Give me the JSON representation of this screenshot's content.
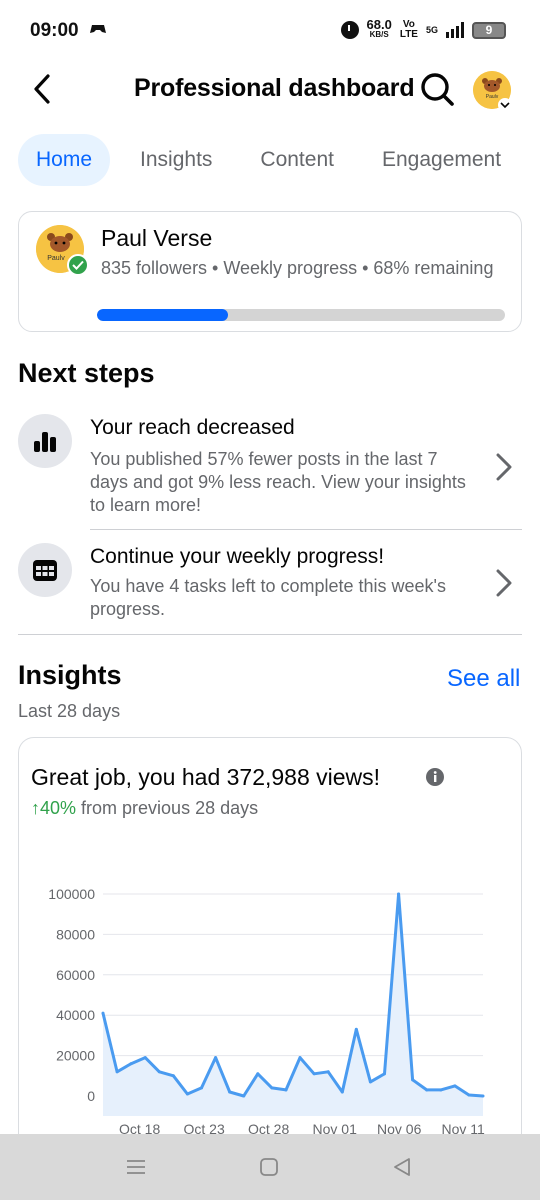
{
  "status_bar": {
    "time": "09:00",
    "speed_value": "68.0",
    "speed_unit": "KB/S",
    "volte_top": "Vo",
    "volte_bottom": "LTE",
    "network": "5G",
    "battery": "9"
  },
  "header": {
    "title": "Professional dashboard",
    "avatar_text": "Paulv"
  },
  "tabs": [
    {
      "label": "Home",
      "active": true
    },
    {
      "label": "Insights",
      "active": false
    },
    {
      "label": "Content",
      "active": false
    },
    {
      "label": "Engagement",
      "active": false
    }
  ],
  "profile": {
    "name": "Paul Verse",
    "meta": "835 followers • Weekly progress • 68% remaining",
    "avatar_text": "Paulv",
    "progress_fraction": 0.32
  },
  "next_steps": {
    "title": "Next steps",
    "items": [
      {
        "icon": "bar-chart-icon",
        "title": "Your reach decreased",
        "description": "You published 57% fewer posts in the last 7 days and got 9% less reach. View your insights to learn more!"
      },
      {
        "icon": "calendar-icon",
        "title": "Continue your weekly progress!",
        "description": "You have 4 tasks left to complete this week's progress."
      }
    ]
  },
  "insights": {
    "title": "Insights",
    "see_all": "See all",
    "period": "Last 28 days",
    "headline": "Great job, you had 372,988 views!",
    "delta_arrow": "↑",
    "delta_value": "40%",
    "delta_rest": " from previous 28 days"
  },
  "colors": {
    "accent": "#0866ff",
    "tab_active_bg": "#e7f3ff",
    "positive": "#31a24c",
    "line": "#4a9bf0",
    "area": "#e6f0fc"
  },
  "chart_data": {
    "type": "area",
    "title": "",
    "xlabel": "",
    "ylabel": "",
    "ylim": [
      0,
      100000
    ],
    "yticks": [
      "100000",
      "80000",
      "60000",
      "40000",
      "20000",
      "0"
    ],
    "xticks": [
      "Oct 18",
      "Oct 23",
      "Oct 28",
      "Nov 01",
      "Nov 06",
      "Nov 11"
    ],
    "series": [
      {
        "values": [
          41000,
          12000,
          16000,
          19000,
          12000,
          10000,
          1000,
          4000,
          19000,
          2000,
          0,
          11000,
          4000,
          3000,
          19000,
          11000,
          12000,
          2000,
          33000,
          7000,
          11000,
          100000,
          8000,
          3000,
          3000,
          5000,
          500,
          0
        ]
      }
    ],
    "grid": true
  }
}
